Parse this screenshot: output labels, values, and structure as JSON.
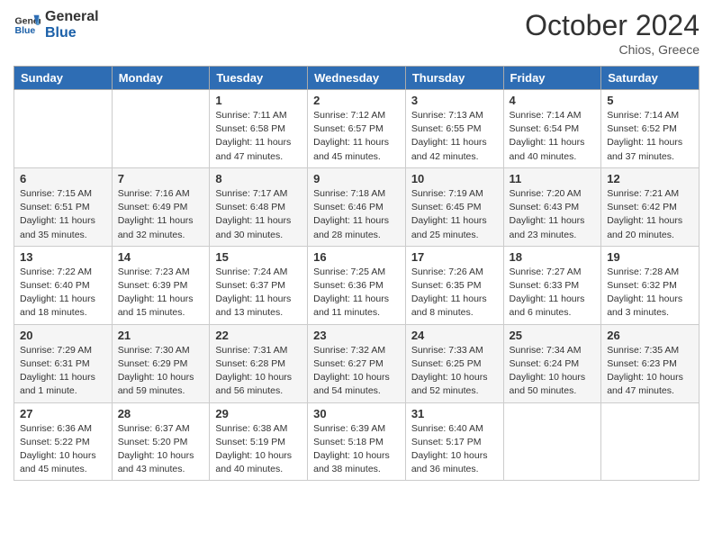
{
  "header": {
    "logo_general": "General",
    "logo_blue": "Blue",
    "month_title": "October 2024",
    "location": "Chios, Greece"
  },
  "days_of_week": [
    "Sunday",
    "Monday",
    "Tuesday",
    "Wednesday",
    "Thursday",
    "Friday",
    "Saturday"
  ],
  "weeks": [
    [
      {
        "day": "",
        "info": ""
      },
      {
        "day": "",
        "info": ""
      },
      {
        "day": "1",
        "info": "Sunrise: 7:11 AM\nSunset: 6:58 PM\nDaylight: 11 hours and 47 minutes."
      },
      {
        "day": "2",
        "info": "Sunrise: 7:12 AM\nSunset: 6:57 PM\nDaylight: 11 hours and 45 minutes."
      },
      {
        "day": "3",
        "info": "Sunrise: 7:13 AM\nSunset: 6:55 PM\nDaylight: 11 hours and 42 minutes."
      },
      {
        "day": "4",
        "info": "Sunrise: 7:14 AM\nSunset: 6:54 PM\nDaylight: 11 hours and 40 minutes."
      },
      {
        "day": "5",
        "info": "Sunrise: 7:14 AM\nSunset: 6:52 PM\nDaylight: 11 hours and 37 minutes."
      }
    ],
    [
      {
        "day": "6",
        "info": "Sunrise: 7:15 AM\nSunset: 6:51 PM\nDaylight: 11 hours and 35 minutes."
      },
      {
        "day": "7",
        "info": "Sunrise: 7:16 AM\nSunset: 6:49 PM\nDaylight: 11 hours and 32 minutes."
      },
      {
        "day": "8",
        "info": "Sunrise: 7:17 AM\nSunset: 6:48 PM\nDaylight: 11 hours and 30 minutes."
      },
      {
        "day": "9",
        "info": "Sunrise: 7:18 AM\nSunset: 6:46 PM\nDaylight: 11 hours and 28 minutes."
      },
      {
        "day": "10",
        "info": "Sunrise: 7:19 AM\nSunset: 6:45 PM\nDaylight: 11 hours and 25 minutes."
      },
      {
        "day": "11",
        "info": "Sunrise: 7:20 AM\nSunset: 6:43 PM\nDaylight: 11 hours and 23 minutes."
      },
      {
        "day": "12",
        "info": "Sunrise: 7:21 AM\nSunset: 6:42 PM\nDaylight: 11 hours and 20 minutes."
      }
    ],
    [
      {
        "day": "13",
        "info": "Sunrise: 7:22 AM\nSunset: 6:40 PM\nDaylight: 11 hours and 18 minutes."
      },
      {
        "day": "14",
        "info": "Sunrise: 7:23 AM\nSunset: 6:39 PM\nDaylight: 11 hours and 15 minutes."
      },
      {
        "day": "15",
        "info": "Sunrise: 7:24 AM\nSunset: 6:37 PM\nDaylight: 11 hours and 13 minutes."
      },
      {
        "day": "16",
        "info": "Sunrise: 7:25 AM\nSunset: 6:36 PM\nDaylight: 11 hours and 11 minutes."
      },
      {
        "day": "17",
        "info": "Sunrise: 7:26 AM\nSunset: 6:35 PM\nDaylight: 11 hours and 8 minutes."
      },
      {
        "day": "18",
        "info": "Sunrise: 7:27 AM\nSunset: 6:33 PM\nDaylight: 11 hours and 6 minutes."
      },
      {
        "day": "19",
        "info": "Sunrise: 7:28 AM\nSunset: 6:32 PM\nDaylight: 11 hours and 3 minutes."
      }
    ],
    [
      {
        "day": "20",
        "info": "Sunrise: 7:29 AM\nSunset: 6:31 PM\nDaylight: 11 hours and 1 minute."
      },
      {
        "day": "21",
        "info": "Sunrise: 7:30 AM\nSunset: 6:29 PM\nDaylight: 10 hours and 59 minutes."
      },
      {
        "day": "22",
        "info": "Sunrise: 7:31 AM\nSunset: 6:28 PM\nDaylight: 10 hours and 56 minutes."
      },
      {
        "day": "23",
        "info": "Sunrise: 7:32 AM\nSunset: 6:27 PM\nDaylight: 10 hours and 54 minutes."
      },
      {
        "day": "24",
        "info": "Sunrise: 7:33 AM\nSunset: 6:25 PM\nDaylight: 10 hours and 52 minutes."
      },
      {
        "day": "25",
        "info": "Sunrise: 7:34 AM\nSunset: 6:24 PM\nDaylight: 10 hours and 50 minutes."
      },
      {
        "day": "26",
        "info": "Sunrise: 7:35 AM\nSunset: 6:23 PM\nDaylight: 10 hours and 47 minutes."
      }
    ],
    [
      {
        "day": "27",
        "info": "Sunrise: 6:36 AM\nSunset: 5:22 PM\nDaylight: 10 hours and 45 minutes."
      },
      {
        "day": "28",
        "info": "Sunrise: 6:37 AM\nSunset: 5:20 PM\nDaylight: 10 hours and 43 minutes."
      },
      {
        "day": "29",
        "info": "Sunrise: 6:38 AM\nSunset: 5:19 PM\nDaylight: 10 hours and 40 minutes."
      },
      {
        "day": "30",
        "info": "Sunrise: 6:39 AM\nSunset: 5:18 PM\nDaylight: 10 hours and 38 minutes."
      },
      {
        "day": "31",
        "info": "Sunrise: 6:40 AM\nSunset: 5:17 PM\nDaylight: 10 hours and 36 minutes."
      },
      {
        "day": "",
        "info": ""
      },
      {
        "day": "",
        "info": ""
      }
    ]
  ]
}
